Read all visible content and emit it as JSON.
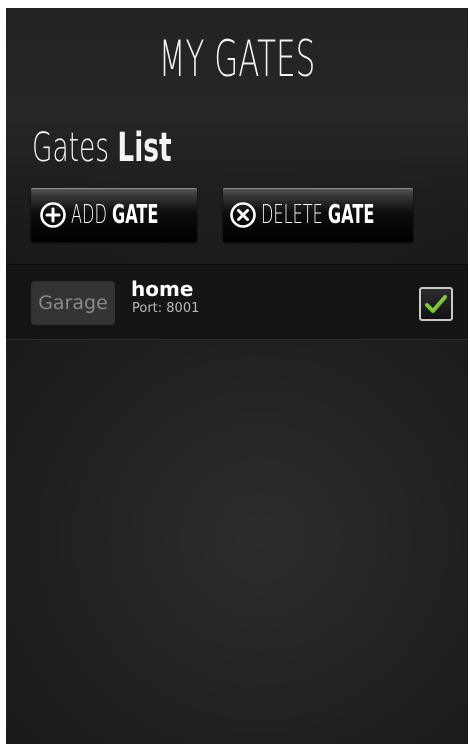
{
  "app": {
    "title": "MY GATES"
  },
  "section": {
    "heading_light": "Gates",
    "heading_bold": "List"
  },
  "toolbar": {
    "add": {
      "label_light": "ADD",
      "label_bold": "GATE",
      "icon": "plus-circle-icon"
    },
    "delete": {
      "label_light": "DELETE",
      "label_bold": "GATE",
      "icon": "x-circle-icon"
    }
  },
  "gates": [
    {
      "type": "Garage",
      "name": "home",
      "port": "Port: 8001",
      "checked": true
    }
  ],
  "colors": {
    "background": "#1f1f1f",
    "row_background": "#141414",
    "check_accent": "#7ec63b",
    "text_primary": "#ffffff",
    "badge_text": "#8a8a8a"
  }
}
